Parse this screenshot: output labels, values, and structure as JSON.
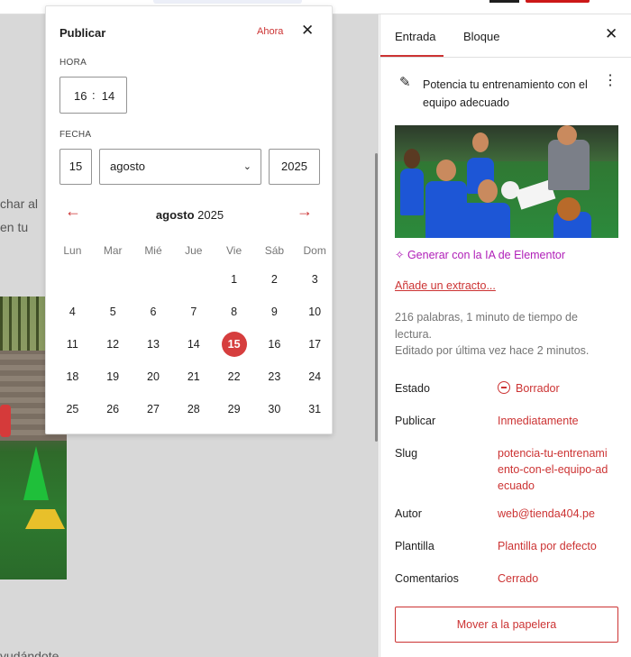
{
  "canvas": {
    "text_line1": "char al",
    "text_line2": "en tu",
    "text_line3": "yudándote"
  },
  "popover": {
    "title": "Publicar",
    "now_label": "Ahora",
    "close_glyph": "✕",
    "time_label": "HORA",
    "hour": "16",
    "minute": "14",
    "date_label": "FECHA",
    "day": "15",
    "month": "agosto",
    "year": "2025",
    "calendar_month": "agosto",
    "calendar_year": "2025",
    "prev_glyph": "←",
    "next_glyph": "→",
    "weekdays": [
      "Lun",
      "Mar",
      "Mié",
      "Jue",
      "Vie",
      "Sáb",
      "Dom"
    ],
    "selected_day": "15",
    "days": [
      "",
      "",
      "",
      "",
      "1",
      "2",
      "3",
      "4",
      "5",
      "6",
      "7",
      "8",
      "9",
      "10",
      "11",
      "12",
      "13",
      "14",
      "15",
      "16",
      "17",
      "18",
      "19",
      "20",
      "21",
      "22",
      "23",
      "24",
      "25",
      "26",
      "27",
      "28",
      "29",
      "30",
      "31"
    ]
  },
  "sidebar": {
    "tab_post": "Entrada",
    "tab_block": "Bloque",
    "close_glyph": "✕",
    "post_title": "Potencia tu entrenamiento con el equipo adecuado",
    "ai_link": "Generar con la IA de Elementor",
    "excerpt_link": "Añade un extracto...",
    "word_count": "216 palabras, 1 minuto de tiempo de lectura.",
    "last_edited": "Editado por última vez hace 2 minutos.",
    "rows": [
      {
        "label": "Estado",
        "value": "Borrador"
      },
      {
        "label": "Publicar",
        "value": "Inmediatamente"
      },
      {
        "label": "Slug",
        "value": "potencia-tu-entrenamiento-con-el-equipo-adecuado"
      },
      {
        "label": "Autor",
        "value": "web@tienda404.pe"
      },
      {
        "label": "Plantilla",
        "value": "Plantilla por defecto"
      },
      {
        "label": "Comentarios",
        "value": "Cerrado"
      }
    ],
    "trash_button": "Mover a la papelera"
  },
  "colors": {
    "accent": "#cc3333",
    "ai_purple": "#b01fb8",
    "selected_day_bg": "#d63e3e"
  }
}
